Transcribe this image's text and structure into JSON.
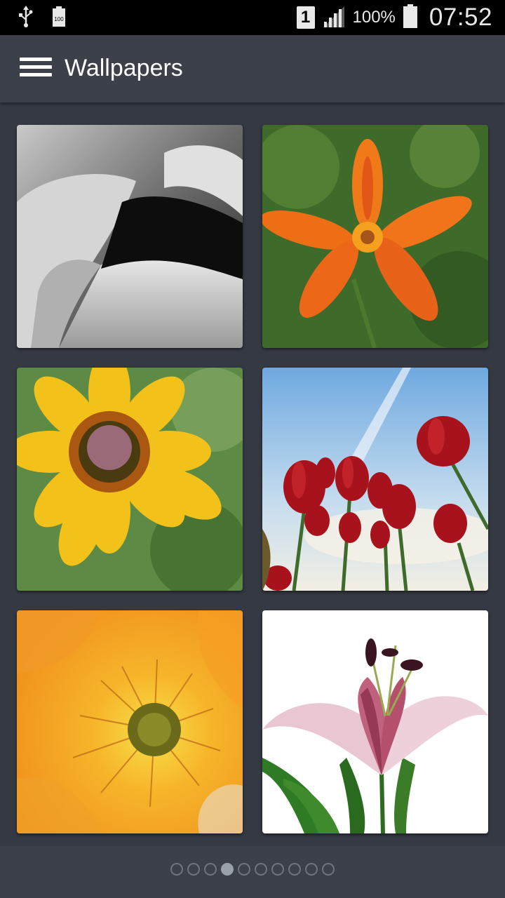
{
  "status_bar": {
    "sim_slot": "1",
    "battery_percent": "100%",
    "time": "07:52",
    "icons": [
      "usb-icon",
      "battery-full-small-icon",
      "sim-icon",
      "signal-icon",
      "battery-icon"
    ]
  },
  "app_bar": {
    "title": "Wallpapers",
    "menu_icon": "hamburger-menu-icon"
  },
  "wallpapers": [
    {
      "subject": "black and white tulip close-up"
    },
    {
      "subject": "orange tiger lily"
    },
    {
      "subject": "yellow black-eyed susan"
    },
    {
      "subject": "red tulips against sky"
    },
    {
      "subject": "orange poppy center"
    },
    {
      "subject": "pink stargazer lily on white"
    }
  ],
  "pager": {
    "total_pages": 10,
    "current_page": 4
  },
  "colors": {
    "background": "#3b4049",
    "status_bar": "#000000",
    "title_text": "#ffffff"
  }
}
